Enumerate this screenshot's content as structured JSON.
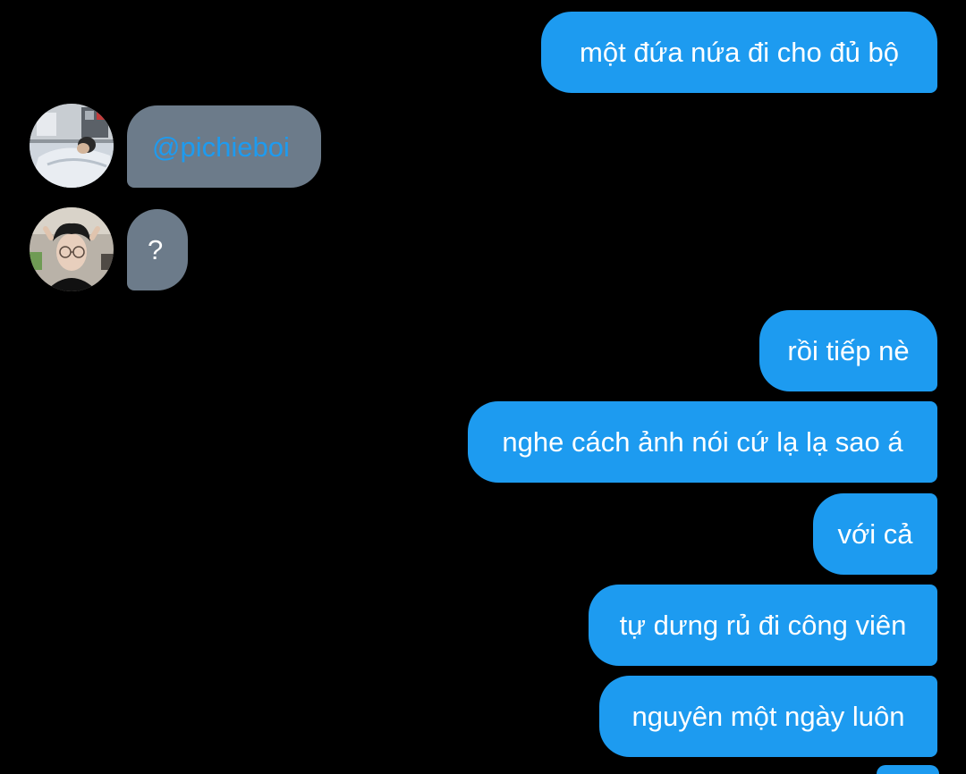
{
  "colors": {
    "background": "#000000",
    "outgoing_bubble": "#1d9bf0",
    "incoming_bubble": "#6c7b8a",
    "mention": "#1d9bf0",
    "text": "#ffffff"
  },
  "messages": {
    "out_0": "một đứa nứa đi cho đủ bộ",
    "in_0_mention": "@pichieboi",
    "in_1": "?",
    "out_1": "rồi tiếp nè",
    "out_2": "nghe cách ảnh nói cứ lạ lạ sao á",
    "out_3": "với cả",
    "out_4": "tự dưng rủ đi công viên",
    "out_5": "nguyên một ngày luôn"
  },
  "avatars": [
    {
      "icon": "avatar-photo-sleeping-person-icon"
    },
    {
      "icon": "avatar-photo-person-glasses-icon"
    }
  ]
}
